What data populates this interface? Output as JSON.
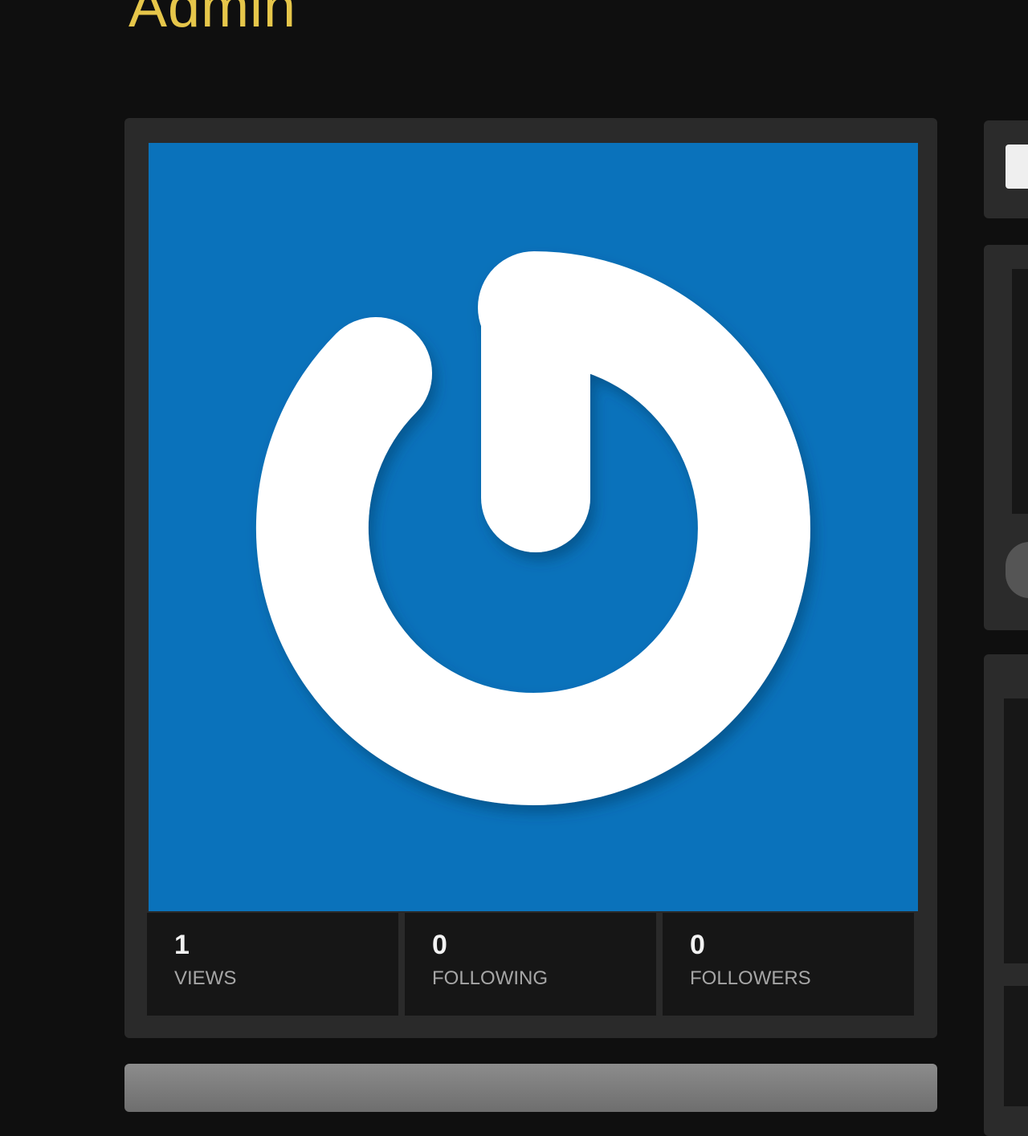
{
  "profile": {
    "name": "Admin"
  },
  "stats": [
    {
      "value": "1",
      "label": "VIEWS"
    },
    {
      "value": "0",
      "label": "FOLLOWING"
    },
    {
      "value": "0",
      "label": "FOLLOWERS"
    }
  ],
  "colors": {
    "accent": "#e6c64a",
    "avatar_bg": "#0a72bb"
  }
}
